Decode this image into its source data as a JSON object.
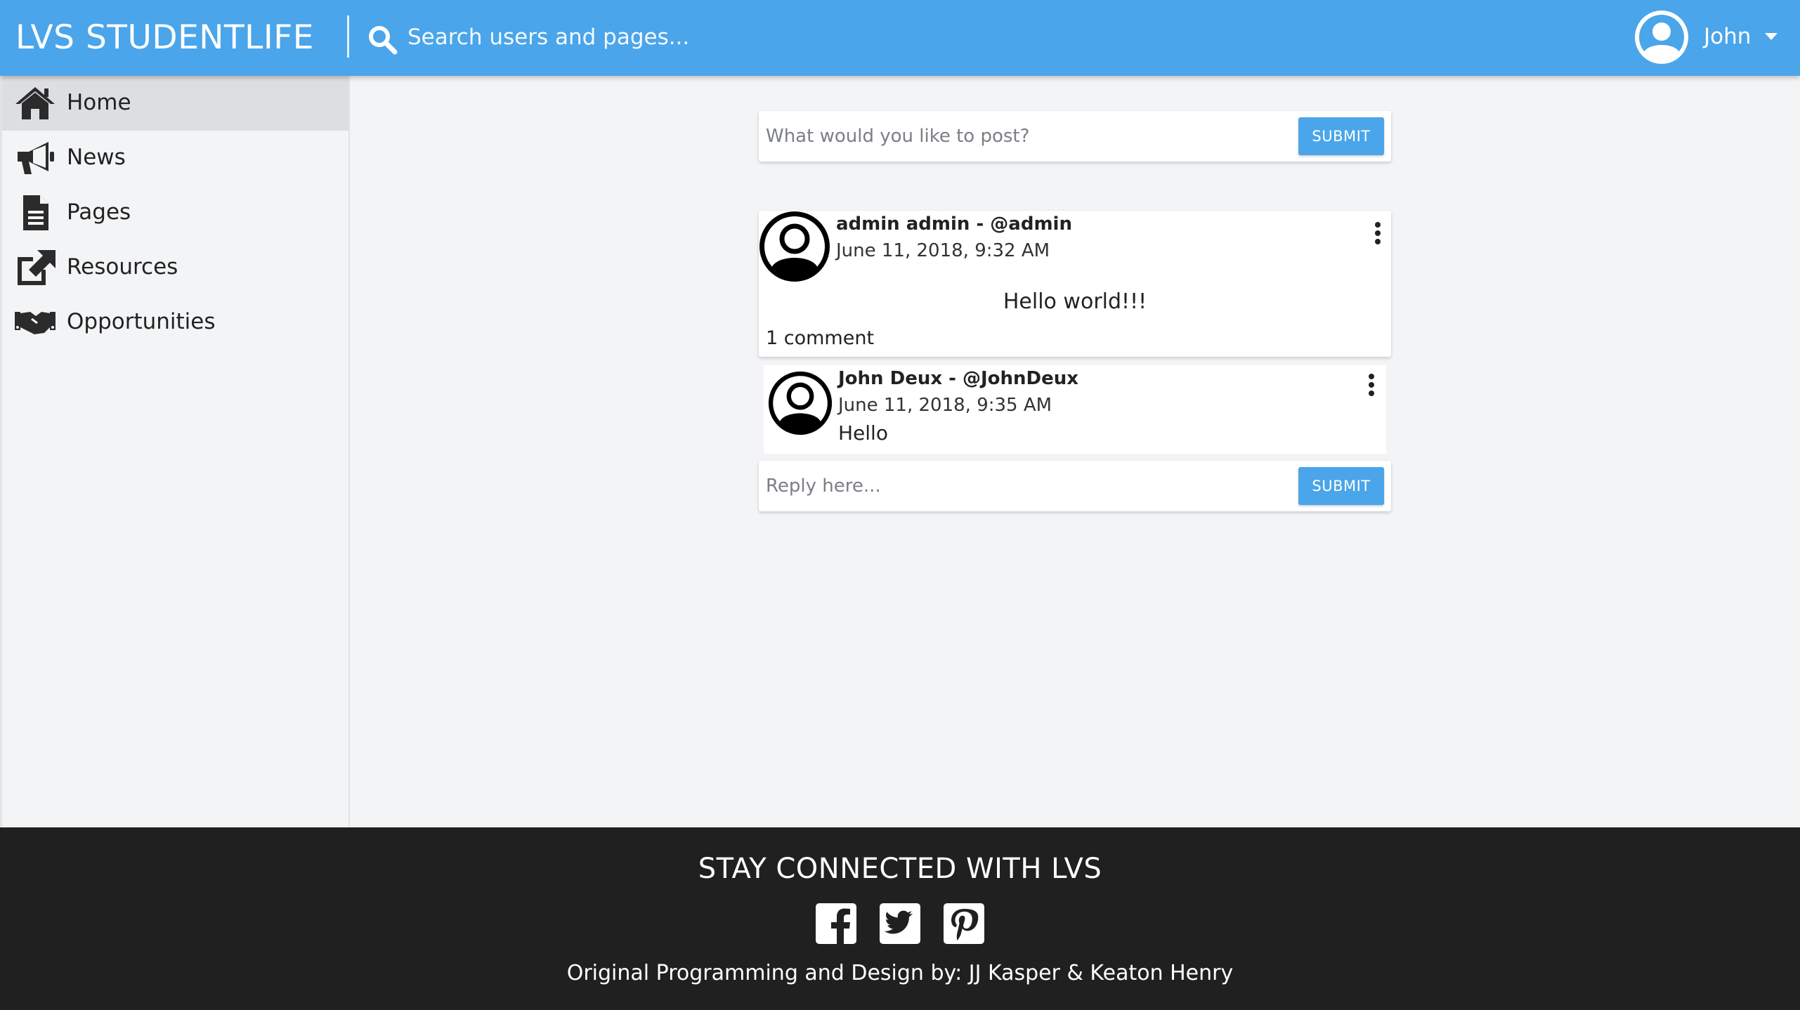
{
  "header": {
    "brand": "LVS STUDENTLIFE",
    "search_placeholder": "Search users and pages...",
    "user_name": "John",
    "accent_color": "#4aa5ea"
  },
  "sidebar": {
    "items": [
      {
        "label": "Home",
        "icon": "home-icon",
        "active": true
      },
      {
        "label": "News",
        "icon": "megaphone-icon",
        "active": false
      },
      {
        "label": "Pages",
        "icon": "document-icon",
        "active": false
      },
      {
        "label": "Resources",
        "icon": "external-link-icon",
        "active": false
      },
      {
        "label": "Opportunities",
        "icon": "handshake-icon",
        "active": false
      }
    ]
  },
  "composer": {
    "placeholder": "What would you like to post?",
    "submit_label": "SUBMIT"
  },
  "post": {
    "author": "admin admin - @admin",
    "timestamp": "June 11, 2018, 9:32 AM",
    "body": "Hello world!!!",
    "comment_count": "1 comment"
  },
  "comment": {
    "author": "John Deux - @JohnDeux",
    "timestamp": "June 11, 2018, 9:35 AM",
    "text": "Hello"
  },
  "reply": {
    "placeholder": "Reply here...",
    "submit_label": "SUBMIT"
  },
  "footer": {
    "heading": "STAY CONNECTED WITH LVS",
    "social": [
      "facebook-icon",
      "twitter-icon",
      "pinterest-icon"
    ],
    "credit": "Original Programming and Design by: JJ Kasper & Keaton Henry"
  }
}
